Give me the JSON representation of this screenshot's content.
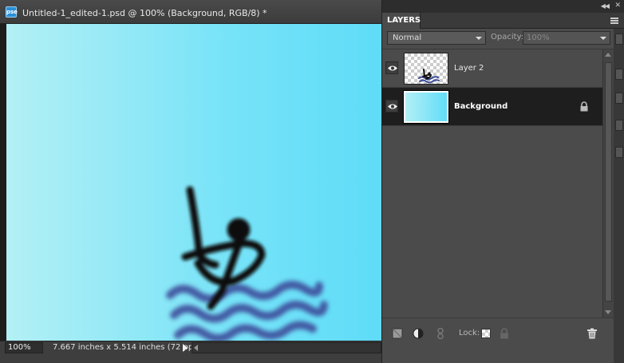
{
  "document": {
    "app_icon_text": "pse",
    "title": "Untitled-1_edited-1.psd @ 100% (Background, RGB/8) *"
  },
  "status": {
    "zoom": "100%",
    "doc_info": "7.667 inches x 5.514 inches (72 ppi)"
  },
  "layers_panel": {
    "tab_label": "LAYERS",
    "blend_mode": "Normal",
    "opacity_label": "Opacity:",
    "opacity_value": "100%",
    "layers": [
      {
        "name": "Layer 2",
        "visible": true,
        "selected": false,
        "locked": false
      },
      {
        "name": "Background",
        "visible": true,
        "selected": true,
        "locked": true
      }
    ],
    "lock_label": "Lock:"
  },
  "icons": [
    "pse-logo-icon",
    "eye-icon",
    "lock-icon",
    "new-layer-icon",
    "adjustment-layer-icon",
    "link-icon",
    "lock-transparent-icon",
    "lock-all-icon",
    "trash-icon",
    "panel-menu-icon",
    "collapse-icon",
    "close-icon"
  ],
  "colors": {
    "canvas_left": "#b3f0f5",
    "canvas_right": "#5fdcf8",
    "stroke_black": "#111111",
    "stroke_wave": "#3c4b9a",
    "selected_row": "#1e1e1e"
  }
}
